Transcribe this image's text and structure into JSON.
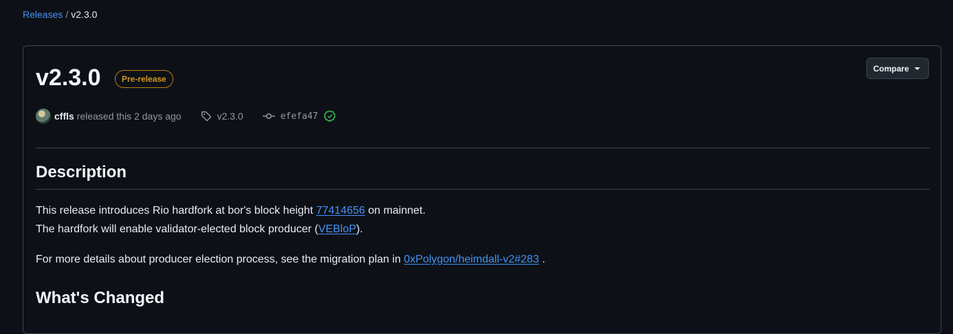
{
  "breadcrumb": {
    "parent": "Releases",
    "separator": "/",
    "current": "v2.3.0"
  },
  "release": {
    "title": "v2.3.0",
    "badge": "Pre-release",
    "compare_label": "Compare",
    "author": "cffls",
    "released_text": "released this 2 days ago",
    "tag": "v2.3.0",
    "commit": "efefa47"
  },
  "body": {
    "description_heading": "Description",
    "line1_prefix": "This release introduces Rio hardfork at bor's block height ",
    "line1_link": "77414656",
    "line1_suffix": " on mainnet.",
    "line2_prefix": "The hardfork will enable validator-elected block producer (",
    "line2_link": "VEBloP",
    "line2_suffix": ").",
    "line3_prefix": "For more details about producer election process, see the migration plan in ",
    "line3_link": "0xPolygon/heimdall-v2#283",
    "line3_suffix": " .",
    "changes_heading": "What's Changed"
  },
  "colors": {
    "background": "#0d1117",
    "link": "#4493f8",
    "prerelease": "#d29922",
    "verified": "#3fb950"
  },
  "icons": {
    "tag": "tag-icon",
    "commit": "git-commit-icon",
    "verified": "verified-check-icon",
    "caret": "triangle-down-icon"
  }
}
